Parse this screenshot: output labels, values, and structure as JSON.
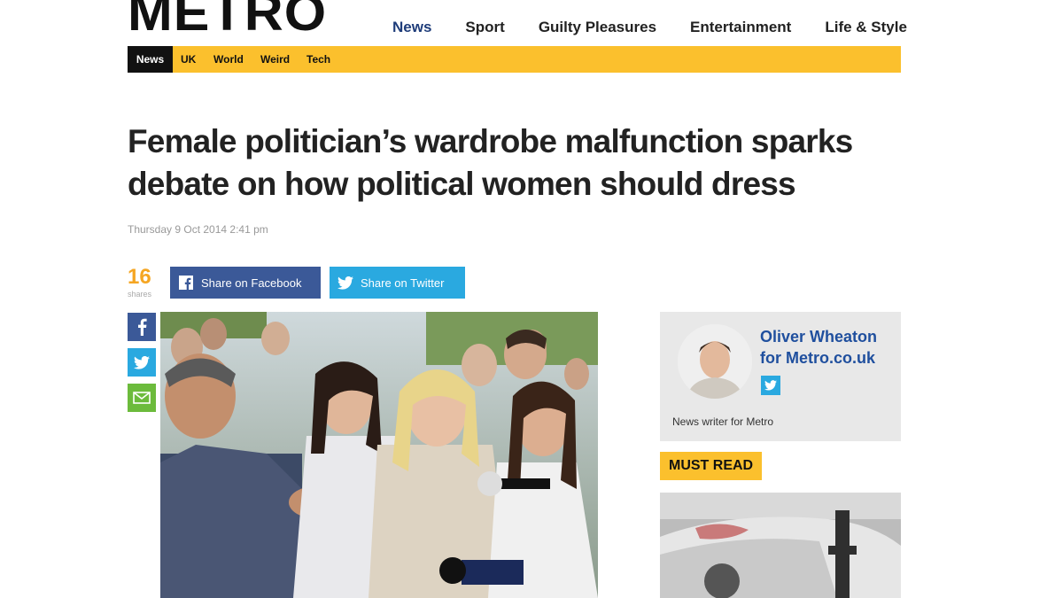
{
  "brand": {
    "logo_text": "METRO"
  },
  "main_nav": {
    "items": [
      "News",
      "Sport",
      "Guilty Pleasures",
      "Entertainment",
      "Life & Style"
    ],
    "active": "News",
    "active_color": "#1f3d7a"
  },
  "sub_nav": {
    "current": "News",
    "items": [
      "UK",
      "World",
      "Weird",
      "Tech"
    ],
    "bar_color": "#fbc02d"
  },
  "article": {
    "headline_line1": "Female politician’s wardrobe malfunction sparks",
    "headline_line2": "debate on how political women should dress",
    "date": "Thursday 9 Oct 2014 2:41 pm"
  },
  "share": {
    "count": "16",
    "count_label": "shares",
    "facebook_label": "Share on Facebook",
    "twitter_label": "Share on Twitter",
    "facebook_color": "#3b5998",
    "twitter_color": "#2aa9e0",
    "side_icons": [
      "facebook-icon",
      "twitter-icon",
      "email-icon"
    ]
  },
  "author": {
    "name_line1": "Oliver Wheaton",
    "name_line2": "for Metro.co.uk",
    "description": "News writer for Metro"
  },
  "sidebar": {
    "must_read_label": "MUST READ"
  }
}
